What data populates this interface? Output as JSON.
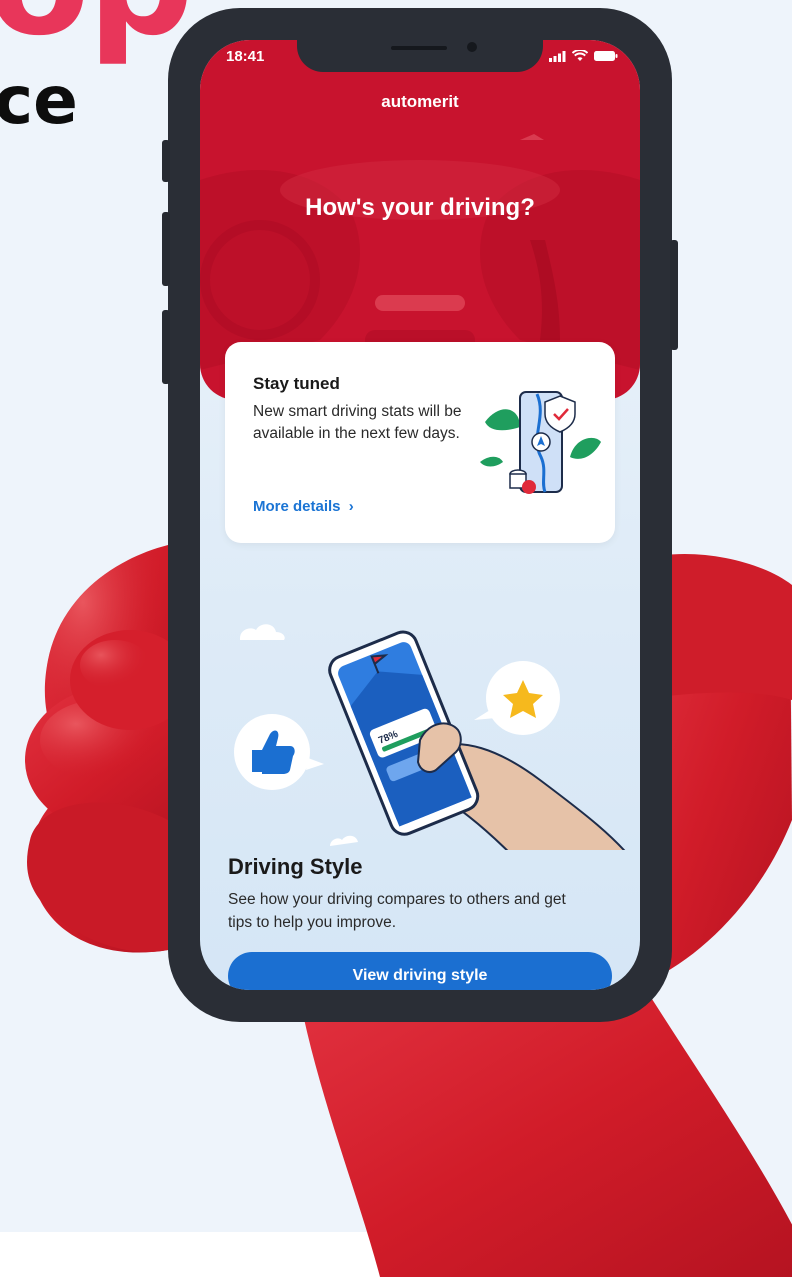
{
  "backdrop": {
    "headline": "op",
    "subheadline": "ce"
  },
  "status_bar": {
    "time": "18:41"
  },
  "header": {
    "brand": "automerit",
    "title": "How's your driving?"
  },
  "notice_card": {
    "title": "Stay tuned",
    "body": "New smart driving stats will be available in the next few days.",
    "link_label": "More details",
    "link_chevron": "›"
  },
  "driving_style": {
    "title": "Driving Style",
    "description": "See how your driving compares to others and get tips to help you improve.",
    "phone_score": "78%",
    "button_label": "View driving style"
  },
  "colors": {
    "hero_red": "#c8132e",
    "accent_blue": "#1b6fd1",
    "hand_red": "#d7222f",
    "page_bg": "#eef4fb"
  },
  "icons": [
    "signal-icon",
    "wifi-icon",
    "battery-icon",
    "chevron-right-icon",
    "thumbs-up-icon",
    "star-icon",
    "shield-check-icon",
    "leaf-icon",
    "location-arrow-icon",
    "flag-icon"
  ]
}
